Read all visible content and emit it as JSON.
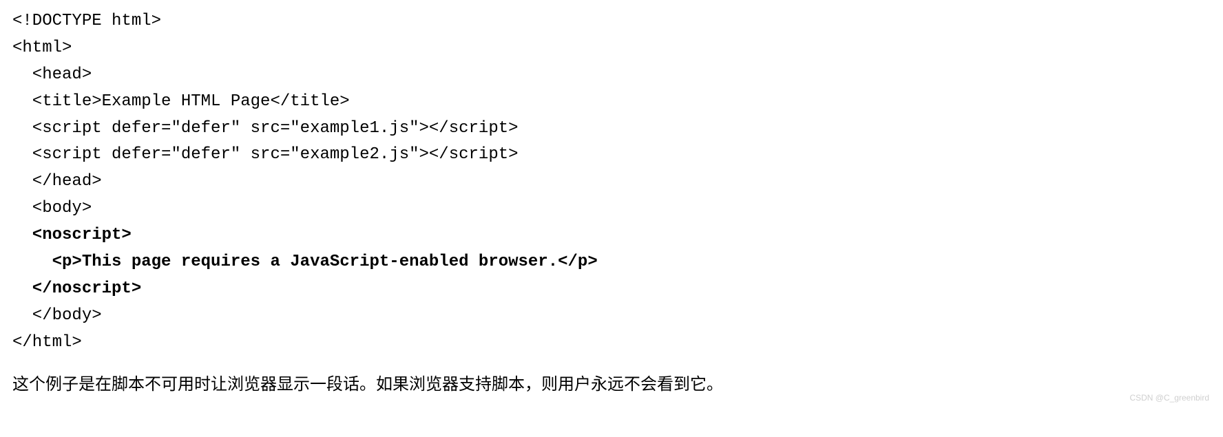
{
  "code": {
    "l1": "<!DOCTYPE html>",
    "l2": "<html>",
    "l3": "  <head>",
    "l4": "  <title>Example HTML Page</title>",
    "l5": "  <script defer=\"defer\" src=\"example1.js\"></script>",
    "l6": "  <script defer=\"defer\" src=\"example2.js\"></script>",
    "l7": "  </head>",
    "l8": "  <body>",
    "l9": "  <noscript>",
    "l10": "    <p>This page requires a JavaScript-enabled browser.</p>",
    "l11": "  </noscript>",
    "l12": "  </body>",
    "l13": "</html>"
  },
  "explanation": "这个例子是在脚本不可用时让浏览器显示一段话。如果浏览器支持脚本，则用户永远不会看到它。",
  "watermark": "CSDN @C_greenbird"
}
